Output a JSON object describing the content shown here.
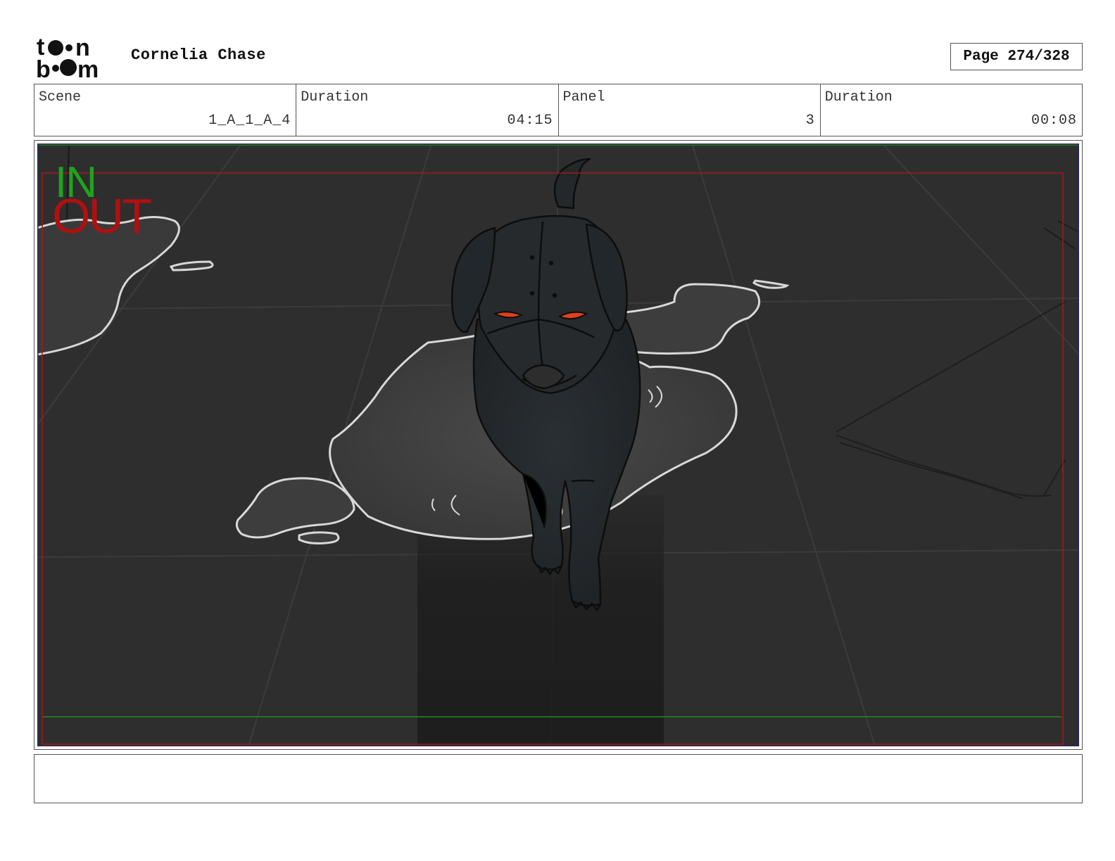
{
  "header": {
    "logo_text": "toon boom",
    "project_title": "Cornelia Chase",
    "page_label": "Page 274/328"
  },
  "info": [
    {
      "label": "Scene",
      "value": "1_A_1_A_4"
    },
    {
      "label": "Duration",
      "value": "04:15"
    },
    {
      "label": "Panel",
      "value": "3"
    },
    {
      "label": "Duration",
      "value": "00:08"
    }
  ],
  "panel": {
    "in_marker": "IN",
    "out_marker": "OUT",
    "colors": {
      "background": "#2e2e2e",
      "in_marker": "#1fa31f",
      "out_marker": "#b01010",
      "puddle_outline": "#d8d8d8",
      "eyes": "#e0401a"
    }
  },
  "notes": {
    "text": ""
  }
}
